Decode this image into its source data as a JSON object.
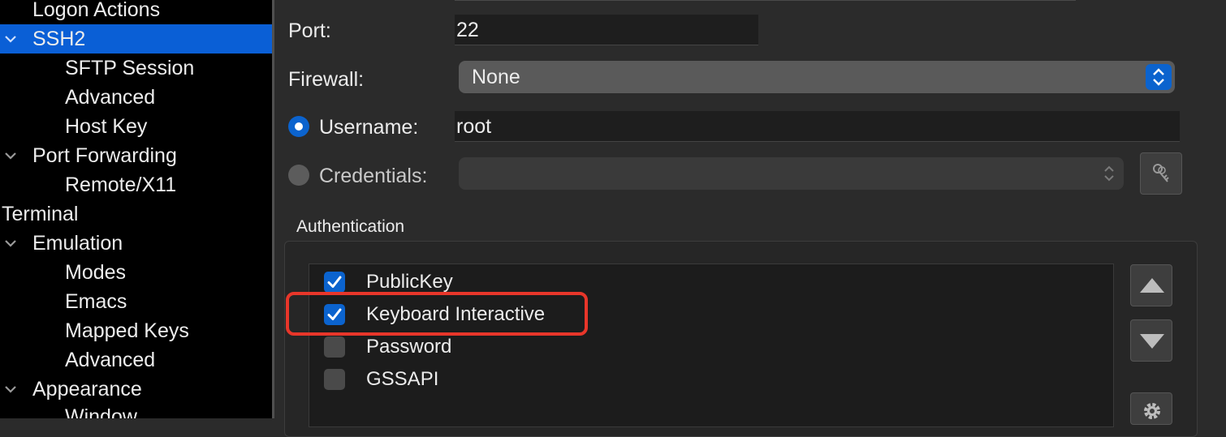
{
  "sidebar": {
    "items": [
      {
        "label": "Logon Actions",
        "level": 1,
        "expanded": null,
        "selected": false
      },
      {
        "label": "SSH2",
        "level": 1,
        "expanded": true,
        "selected": true
      },
      {
        "label": "SFTP Session",
        "level": 2,
        "expanded": null,
        "selected": false
      },
      {
        "label": "Advanced",
        "level": 2,
        "expanded": null,
        "selected": false
      },
      {
        "label": "Host Key",
        "level": 2,
        "expanded": null,
        "selected": false
      },
      {
        "label": "Port Forwarding",
        "level": 1,
        "expanded": true,
        "selected": false
      },
      {
        "label": "Remote/X11",
        "level": 2,
        "expanded": null,
        "selected": false
      },
      {
        "label": "Terminal",
        "level": 0,
        "expanded": null,
        "selected": false
      },
      {
        "label": "Emulation",
        "level": 1,
        "expanded": true,
        "selected": false
      },
      {
        "label": "Modes",
        "level": 2,
        "expanded": null,
        "selected": false
      },
      {
        "label": "Emacs",
        "level": 2,
        "expanded": null,
        "selected": false
      },
      {
        "label": "Mapped Keys",
        "level": 2,
        "expanded": null,
        "selected": false
      },
      {
        "label": "Advanced",
        "level": 2,
        "expanded": null,
        "selected": false
      },
      {
        "label": "Appearance",
        "level": 1,
        "expanded": true,
        "selected": false
      },
      {
        "label": "Window",
        "level": 2,
        "expanded": null,
        "selected": false
      }
    ]
  },
  "form": {
    "port_label": "Port:",
    "port_value": "22",
    "firewall_label": "Firewall:",
    "firewall_value": "None",
    "username_label": "Username:",
    "username_value": "root",
    "username_selected": true,
    "credentials_label": "Credentials:",
    "credentials_value": "",
    "credentials_selected": false
  },
  "authentication": {
    "title": "Authentication",
    "methods": [
      {
        "label": "PublicKey",
        "checked": true
      },
      {
        "label": "Keyboard Interactive",
        "checked": true
      },
      {
        "label": "Password",
        "checked": false
      },
      {
        "label": "GSSAPI",
        "checked": false
      }
    ]
  },
  "icons": {
    "move_up": "triangle-up-icon",
    "move_down": "triangle-down-icon",
    "settings": "gear-icon",
    "credentials_manager": "keys-icon"
  },
  "colors": {
    "accent": "#0b63ce",
    "selection": "#0a5fd6",
    "highlight": "#e8362a"
  }
}
